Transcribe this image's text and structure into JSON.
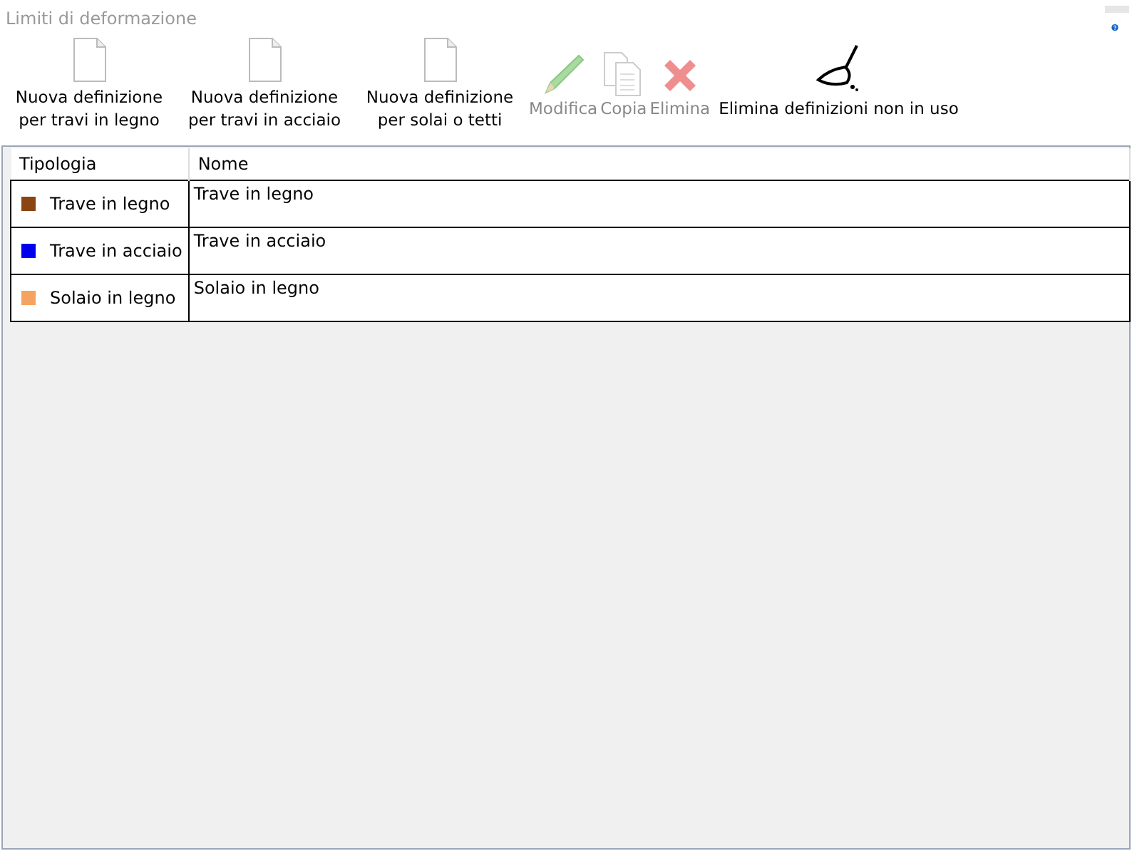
{
  "window": {
    "title": "Limiti di deformazione"
  },
  "toolbar": [
    {
      "kind": "new",
      "label": "Nuova definizione per travi in legno",
      "disabled": false
    },
    {
      "kind": "new",
      "label": "Nuova definizione per travi in acciaio",
      "disabled": false
    },
    {
      "kind": "new",
      "label": "Nuova definizione per solai o tetti",
      "disabled": false
    },
    {
      "kind": "edit",
      "label": "Modifica",
      "disabled": true
    },
    {
      "kind": "copy",
      "label": "Copia",
      "disabled": true
    },
    {
      "kind": "delete",
      "label": "Elimina",
      "disabled": true
    },
    {
      "kind": "clean",
      "label": "Elimina definizioni non in uso",
      "disabled": false
    }
  ],
  "table": {
    "columns": [
      "Tipologia",
      "Nome"
    ],
    "rows": [
      {
        "type": "Trave in legno",
        "color": "#8b4513",
        "name": "Trave in legno"
      },
      {
        "type": "Trave in acciaio",
        "color": "#0000ee",
        "name": "Trave in acciaio"
      },
      {
        "type": "Solaio in legno",
        "color": "#f4a460",
        "name": "Solaio in legno"
      }
    ]
  }
}
